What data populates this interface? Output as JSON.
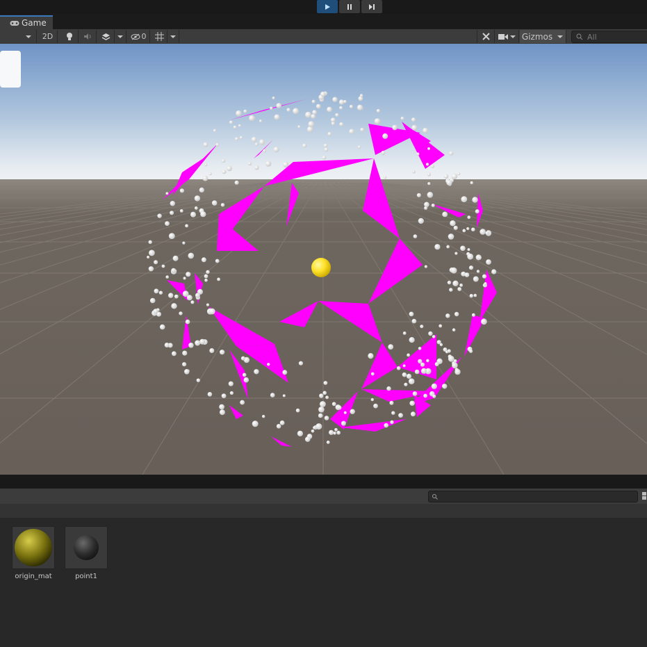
{
  "window": {
    "tab_title": "Game"
  },
  "toolbar": {
    "twod_label": "2D",
    "hidden_count": "0",
    "gizmos_label": "Gizmos",
    "search_placeholder": "All"
  },
  "scene": {
    "sky_top_color": "#6f94c6",
    "horizon_color": "#e8edf2",
    "ground_color": "#6a635c",
    "mesh_color": "#ff00ff",
    "point_color": "#f2f2f2",
    "origin_color": "#ffe22a"
  },
  "project": {
    "search_placeholder": "",
    "assets": [
      {
        "name": "origin_mat"
      },
      {
        "name": "point1"
      }
    ]
  },
  "icons": [
    "play-icon",
    "pause-icon",
    "step-icon",
    "game-controller-icon",
    "light-icon",
    "audio-icon",
    "layers-icon",
    "visibility-icon",
    "grid-icon",
    "tools-icon",
    "camera-icon",
    "search-icon"
  ]
}
